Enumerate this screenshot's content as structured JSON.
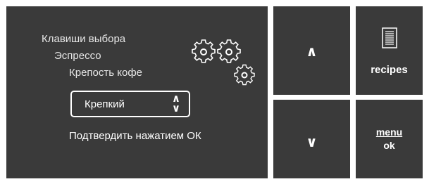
{
  "display": {
    "menu_path": [
      "Клавиши выбора",
      "Эспрессо",
      "Крепость кофе"
    ],
    "selector": {
      "value": "Крепкий",
      "up_glyph": "∧",
      "down_glyph": "∨"
    },
    "confirm_text": "Подтвердить нажатием ОК",
    "icon": "gears-icon"
  },
  "buttons": {
    "up": {
      "glyph": "∧",
      "icon": "chevron-up-icon"
    },
    "down": {
      "glyph": "∨",
      "icon": "chevron-down-icon"
    },
    "recipes": {
      "label": "recipes",
      "icon": "recipe-document-icon"
    },
    "menu": {
      "top_label": "menu",
      "bottom_label": "ok"
    }
  },
  "colors": {
    "panel_background": "#3a3a3a",
    "page_background": "#ffffff",
    "text": "#ffffff"
  }
}
